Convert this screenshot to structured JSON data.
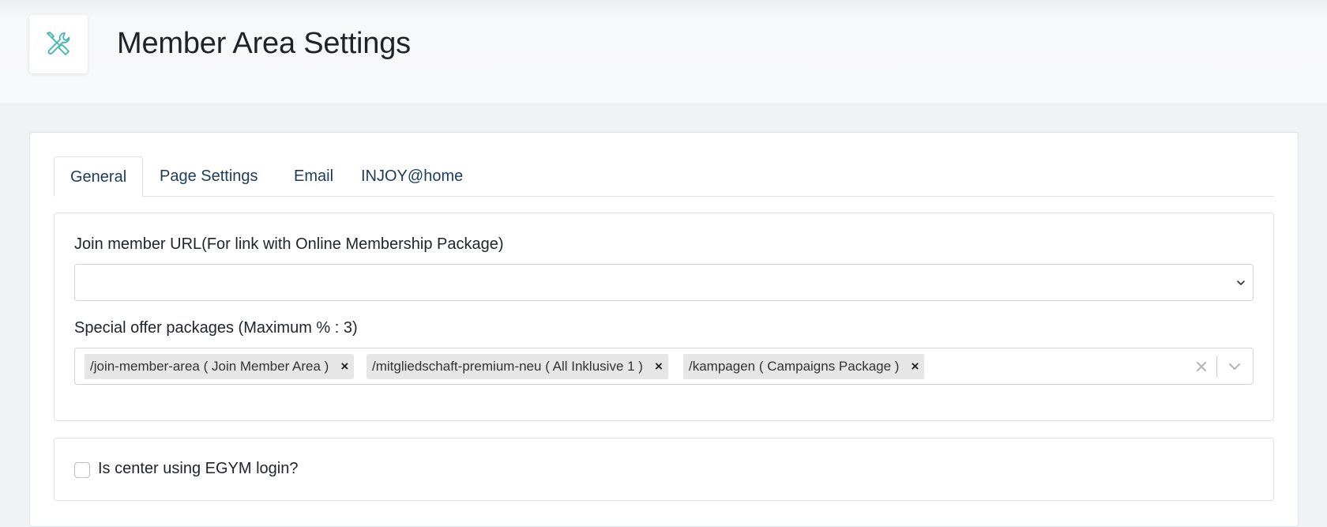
{
  "header": {
    "title": "Member Area Settings",
    "icon": "tools-icon",
    "icon_color": "#3fb6b0"
  },
  "tabs": [
    {
      "label": "General",
      "active": true
    },
    {
      "label": "Page Settings",
      "active": false
    },
    {
      "label": "Email",
      "active": false
    },
    {
      "label": "INJOY@home",
      "active": false
    }
  ],
  "general": {
    "join_url": {
      "label": "Join member URL(For link with Online Membership Package)",
      "value": ""
    },
    "special_offers": {
      "label": "Special offer packages (Maximum % : 3)",
      "chips": [
        {
          "label": "/join-member-area ( Join Member Area )",
          "remove": "×"
        },
        {
          "label": "/mitgliedschaft-premium-neu ( All Inklusive 1 )",
          "remove": "×"
        },
        {
          "label": "/kampagen ( Campaigns Package )",
          "remove": "×"
        }
      ]
    },
    "egym": {
      "label": "Is center using EGYM login?",
      "checked": false
    }
  },
  "colors": {
    "tab_text": "#1d3b5c",
    "border": "#dfe2e6",
    "chip_bg": "#e6e6e6"
  }
}
